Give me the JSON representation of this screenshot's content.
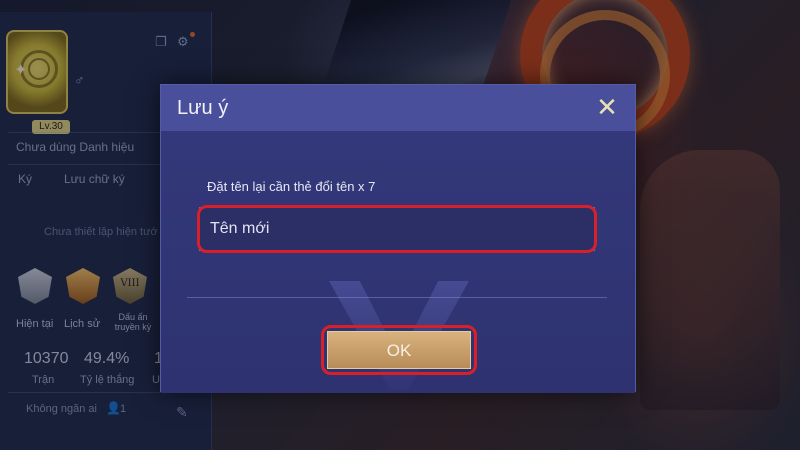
{
  "profile": {
    "level": "Lv.30",
    "gender_icon": "male-symbol",
    "title_label": "Chưa dùng Danh hiệu",
    "signature_key": "Ký",
    "signature_value": "Lưu chữ ký",
    "not_setup_text": "Chưa thiết lập hiện tướ",
    "badges": [
      {
        "label": "Hiện tại"
      },
      {
        "label": "Lịch sử"
      },
      {
        "label": "Dấu ấn truyền kỳ",
        "roman": "VIII"
      }
    ],
    "stats": [
      {
        "value": "10370",
        "label": "Trận"
      },
      {
        "value": "49.4%",
        "label": "Tỷ lệ thắng"
      },
      {
        "value": "1",
        "label": "U"
      }
    ],
    "bottom": {
      "status_text": "Không ngăn ai",
      "count": "1"
    }
  },
  "dialog": {
    "title": "Lưu ý",
    "hint": "Đặt tên lại cần thẻ đổi tên x 7",
    "input_placeholder": "Tên mới",
    "ok_label": "OK",
    "close_glyph": "✕"
  },
  "colors": {
    "dialog_bg": "#3a3e80",
    "ok_button": "#c9a06c",
    "highlight": "#d8202a"
  }
}
